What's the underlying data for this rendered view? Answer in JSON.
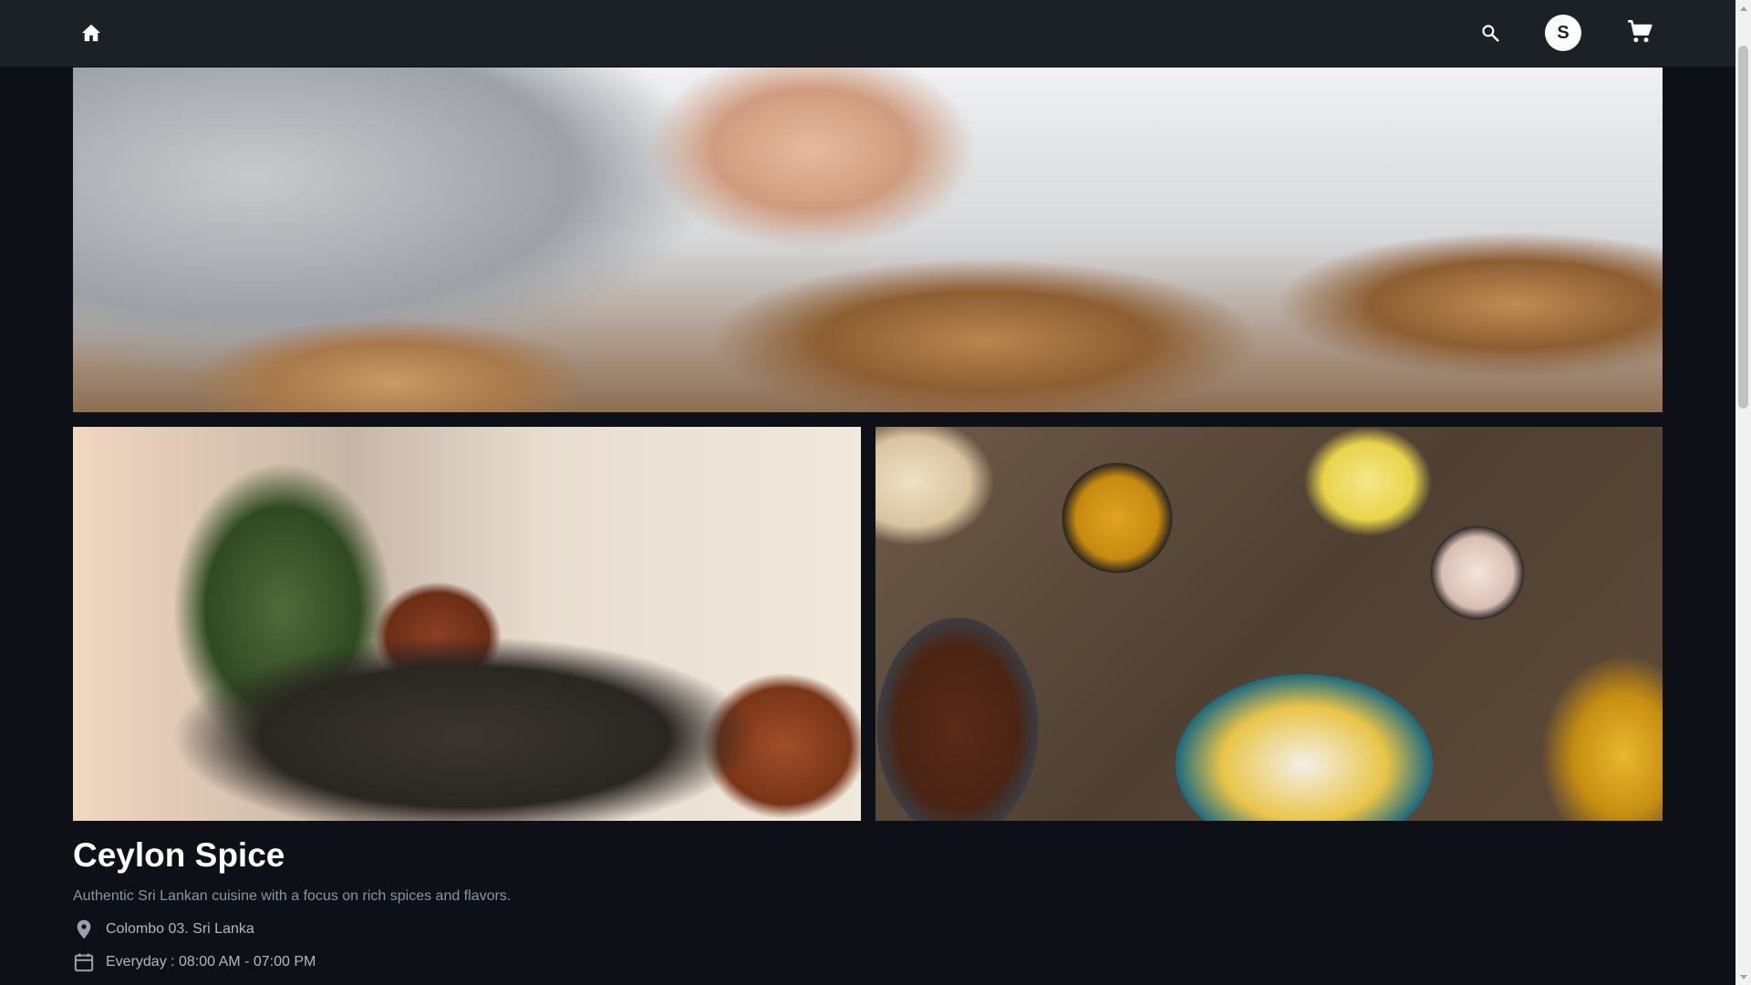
{
  "header": {
    "home_icon": "home-icon",
    "search_icon": "search-icon",
    "avatar_letter": "S",
    "cart_icon": "shopping-cart-icon"
  },
  "gallery": {
    "images": [
      {
        "name": "hero-image",
        "description_icon": "food-plating-photo"
      },
      {
        "name": "dining-room-image",
        "description_icon": "restaurant-interior-photo"
      },
      {
        "name": "spices-image",
        "description_icon": "spices-and-rice-photo"
      }
    ]
  },
  "restaurant": {
    "name": "Ceylon Spice",
    "description": "Authentic Sri Lankan cuisine with a focus on rich spices and flavors.",
    "location": "Colombo 03. Sri Lanka",
    "hours": "Everyday : 08:00 AM - 07:00 PM",
    "location_icon": "location-pin-icon",
    "hours_icon": "calendar-icon"
  },
  "colors": {
    "background": "#0d1117",
    "topbar": "#1c2128",
    "muted_text": "#8b93a1"
  }
}
